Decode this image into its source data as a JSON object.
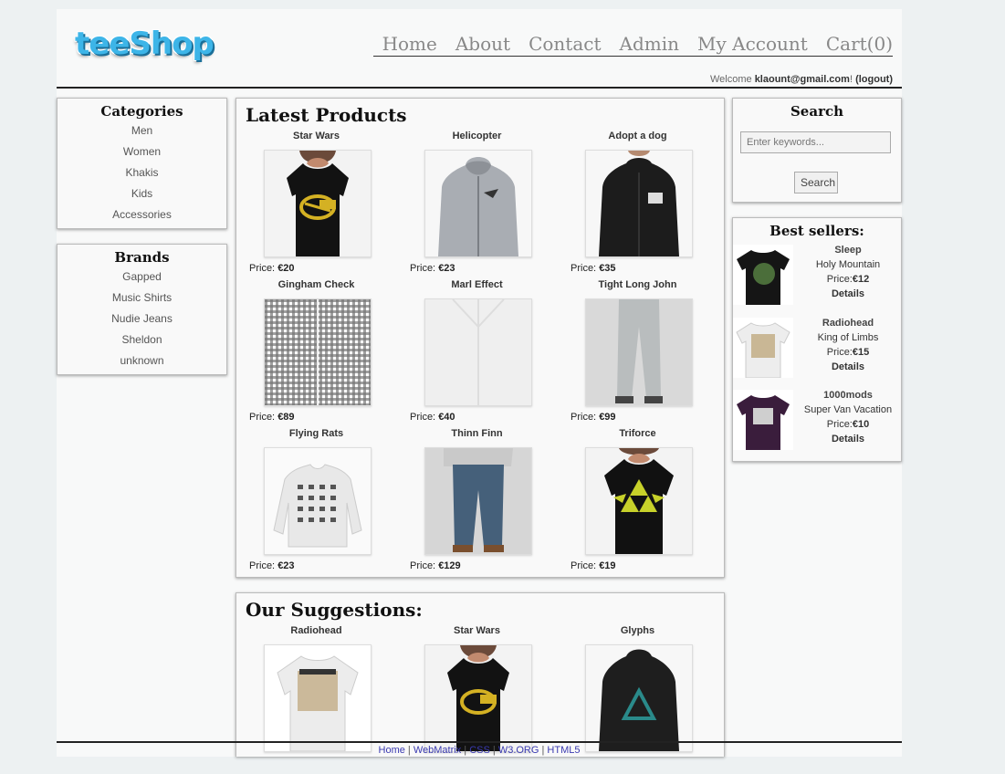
{
  "brand": {
    "logo_text": "teeShop",
    "logo_color": "#3db5e8"
  },
  "nav": [
    {
      "label": "Home"
    },
    {
      "label": "About"
    },
    {
      "label": "Contact"
    },
    {
      "label": "Admin"
    },
    {
      "label": "My Account"
    },
    {
      "label": "Cart(0)"
    }
  ],
  "welcome": {
    "prefix": "Welcome ",
    "user": "klaount@gmail.com",
    "sep": "! ",
    "logout": "(logout)"
  },
  "categories": {
    "title": "Categories",
    "items": [
      {
        "label": "Men"
      },
      {
        "label": "Women"
      },
      {
        "label": "Khakis"
      },
      {
        "label": "Kids"
      },
      {
        "label": "Accessories"
      }
    ]
  },
  "brands": {
    "title": "Brands",
    "items": [
      {
        "label": "Gapped"
      },
      {
        "label": "Music Shirts"
      },
      {
        "label": "Nudie Jeans"
      },
      {
        "label": "Sheldon"
      },
      {
        "label": "unknown"
      }
    ]
  },
  "latest": {
    "title": "Latest Products",
    "products": [
      {
        "name": "Star Wars",
        "price_label": "Price: ",
        "price": "€20",
        "image": "black-tshirt-woman"
      },
      {
        "name": "Helicopter",
        "price_label": "Price: ",
        "price": "€23",
        "image": "grey-hoodie"
      },
      {
        "name": "Adopt a dog",
        "price_label": "Price: ",
        "price": "€35",
        "image": "black-hoodie"
      },
      {
        "name": "Gingham Check",
        "price_label": "Price: ",
        "price": "€89",
        "image": "gingham-shirt"
      },
      {
        "name": "Marl Effect",
        "price_label": "Price: ",
        "price": "€40",
        "image": "white-shirt"
      },
      {
        "name": "Tight Long John",
        "price_label": "Price: ",
        "price": "€99",
        "image": "grey-jeans"
      },
      {
        "name": "Flying Rats",
        "price_label": "Price: ",
        "price": "€23",
        "image": "white-sweatshirt"
      },
      {
        "name": "Thinn Finn",
        "price_label": "Price: ",
        "price": "€129",
        "image": "blue-jeans"
      },
      {
        "name": "Triforce",
        "price_label": "Price: ",
        "price": "€19",
        "image": "black-tshirt-triforce"
      }
    ]
  },
  "suggestions": {
    "title": "Our Suggestions:",
    "products": [
      {
        "name": "Radiohead",
        "image": "white-tshirt-radiohead"
      },
      {
        "name": "Star Wars",
        "image": "black-tshirt-woman"
      },
      {
        "name": "Glyphs",
        "image": "black-hoodie-glyphs"
      }
    ]
  },
  "search": {
    "title": "Search",
    "placeholder": "Enter keywords...",
    "button": "Search"
  },
  "bestsellers": {
    "title": "Best sellers:",
    "items": [
      {
        "brand": "Sleep",
        "name": "Holy Mountain",
        "price_label": "Price:",
        "price": "€12",
        "details": "Details",
        "image": "black-tshirt-green"
      },
      {
        "brand": "Radiohead",
        "name": "King of Limbs",
        "price_label": "Price:",
        "price": "€15",
        "details": "Details",
        "image": "white-tshirt-radiohead"
      },
      {
        "brand": "1000mods",
        "name": "Super Van Vacation",
        "price_label": "Price:",
        "price": "€10",
        "details": "Details",
        "image": "purple-tshirt"
      }
    ]
  },
  "footer": {
    "links": [
      {
        "label": "Home"
      },
      {
        "label": "WebMatrix"
      },
      {
        "label": "CSS"
      },
      {
        "label": "W3.ORG"
      },
      {
        "label": "HTML5"
      }
    ],
    "sep": " | "
  }
}
